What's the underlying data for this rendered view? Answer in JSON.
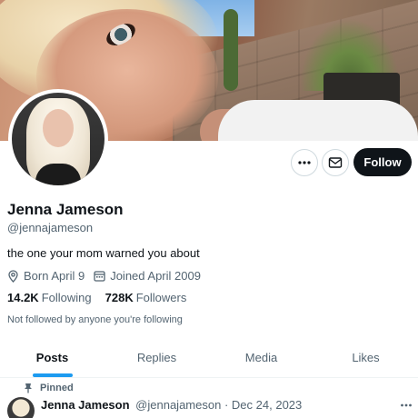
{
  "profile": {
    "name": "Jenna Jameson",
    "handle": "@jennajameson",
    "bio": "the one your mom warned you about",
    "born": "Born April 9",
    "joined": "Joined April 2009",
    "following_count": "14.2K",
    "following_label": "Following",
    "followers_count": "728K",
    "followers_label": "Followers",
    "not_followed_text": "Not followed by anyone you're following"
  },
  "actions": {
    "follow_label": "Follow",
    "more_icon": "more-horizontal-icon",
    "message_icon": "envelope-icon"
  },
  "tabs": [
    {
      "label": "Posts",
      "active": true
    },
    {
      "label": "Replies",
      "active": false
    },
    {
      "label": "Media",
      "active": false
    },
    {
      "label": "Likes",
      "active": false
    }
  ],
  "post": {
    "pinned_label": "Pinned",
    "author_name": "Jenna Jameson",
    "author_handle": "@jennajameson",
    "separator": "·",
    "date": "Dec 24, 2023",
    "text": ""
  },
  "colors": {
    "accent": "#1d9bf0",
    "follow_button": "#0f1419",
    "secondary_text": "#536471"
  }
}
